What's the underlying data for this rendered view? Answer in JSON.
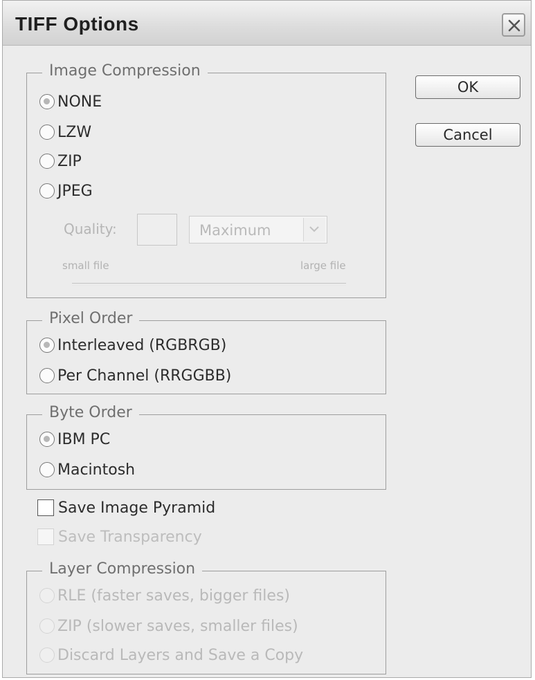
{
  "window": {
    "title": "TIFF Options",
    "close_icon": "close-icon"
  },
  "buttons": {
    "ok": "OK",
    "cancel": "Cancel"
  },
  "image_compression": {
    "legend": "Image Compression",
    "options": [
      {
        "label": "NONE",
        "checked": true
      },
      {
        "label": "LZW",
        "checked": false
      },
      {
        "label": "ZIP",
        "checked": false
      },
      {
        "label": "JPEG",
        "checked": false
      }
    ],
    "quality_label": "Quality:",
    "quality_value": "",
    "quality_select": "Maximum",
    "small_file": "small file",
    "large_file": "large file"
  },
  "pixel_order": {
    "legend": "Pixel Order",
    "options": [
      {
        "label": "Interleaved (RGBRGB)",
        "checked": true
      },
      {
        "label": "Per Channel (RRGGBB)",
        "checked": false
      }
    ]
  },
  "byte_order": {
    "legend": "Byte Order",
    "options": [
      {
        "label": "IBM PC",
        "checked": true
      },
      {
        "label": "Macintosh",
        "checked": false
      }
    ]
  },
  "checkboxes": {
    "save_image_pyramid": {
      "label": "Save Image Pyramid",
      "checked": false,
      "enabled": true
    },
    "save_transparency": {
      "label": "Save Transparency",
      "checked": false,
      "enabled": false
    }
  },
  "layer_compression": {
    "legend": "Layer Compression",
    "options": [
      {
        "label": "RLE (faster saves, bigger files)",
        "checked": false
      },
      {
        "label": "ZIP (slower saves, smaller files)",
        "checked": false
      },
      {
        "label": "Discard Layers and Save a Copy",
        "checked": false
      }
    ]
  },
  "colors": {
    "dialog_bg": "#ececec",
    "disabled_text": "#b9b9b9",
    "group_border": "#9d9d9d"
  }
}
